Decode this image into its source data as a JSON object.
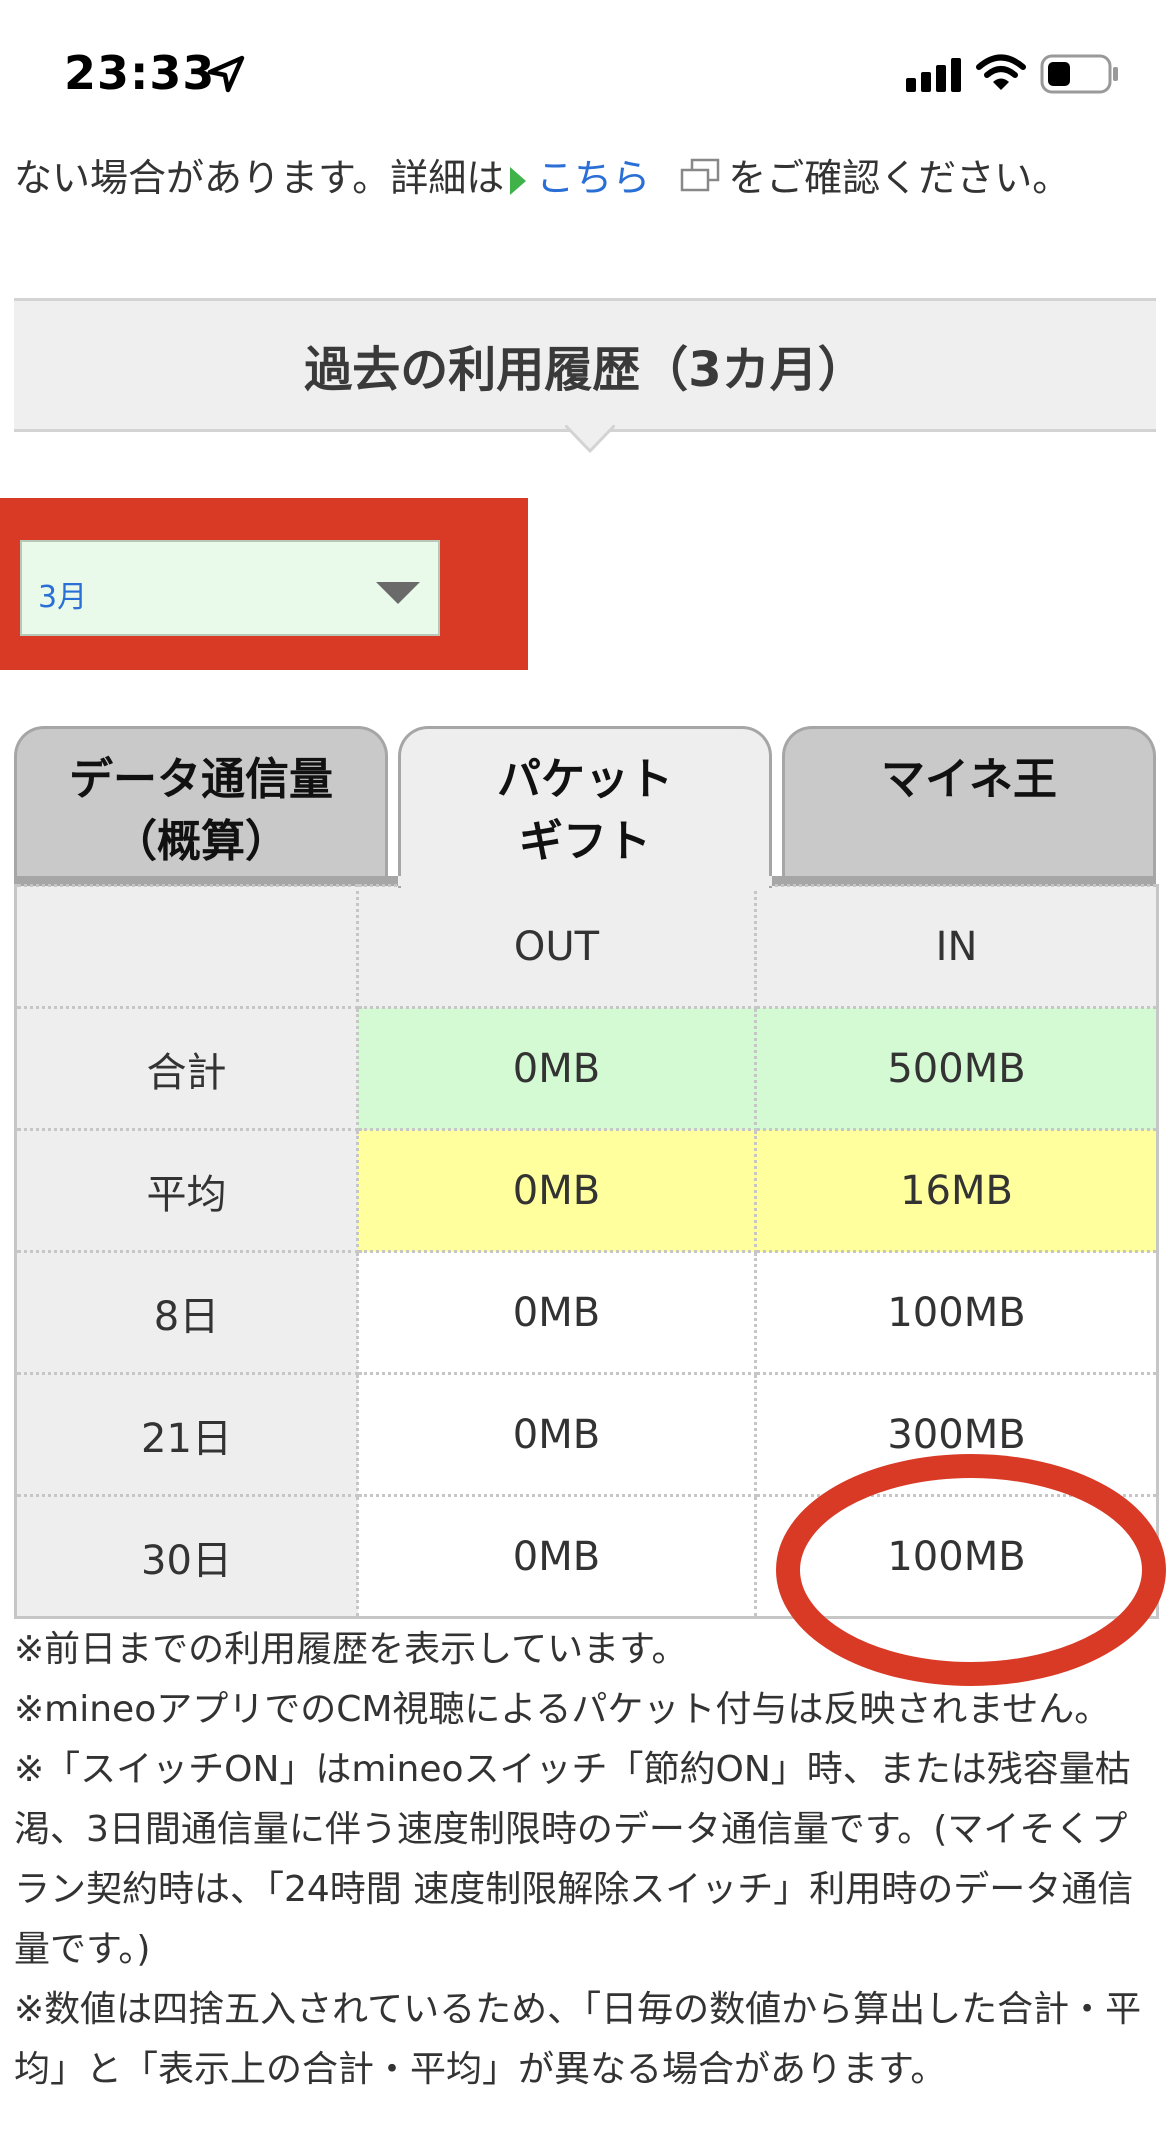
{
  "status_bar": {
    "time": "23:33"
  },
  "intro": {
    "text_before": "ない場合があります。詳細は",
    "link_text": "こちら",
    "text_after": "をご確認ください。"
  },
  "section": {
    "title": "過去の利用履歴（3カ月）"
  },
  "month_select": {
    "value": "3月"
  },
  "tabs": [
    {
      "line1": "データ通信量",
      "line2": "（概算）",
      "active": false
    },
    {
      "line1": "パケット",
      "line2": "ギフト",
      "active": true
    },
    {
      "line1": "マイネ王",
      "line2": "",
      "active": false
    }
  ],
  "table": {
    "columns": [
      "",
      "OUT",
      "IN"
    ],
    "rows": [
      {
        "label": "合計",
        "out": "0MB",
        "in": "500MB"
      },
      {
        "label": "平均",
        "out": "0MB",
        "in": "16MB"
      },
      {
        "label": "8日",
        "out": "0MB",
        "in": "100MB"
      },
      {
        "label": "21日",
        "out": "0MB",
        "in": "300MB"
      },
      {
        "label": "30日",
        "out": "0MB",
        "in": "100MB"
      }
    ]
  },
  "notes": [
    "※前日までの利用履歴を表示しています。",
    "※mineoアプリでのCM視聴によるパケット付与は反映されません。",
    "※「スイッチON」はmineoスイッチ「節約ON」時、または残容量枯渇、3日間通信量に伴う速度制限時のデータ通信量です。(マイそくプラン契約時は、「24時間 速度制限解除スイッチ」利用時のデータ通信量です。)",
    "※数値は四捨五入されているため、「日毎の数値から算出した合計・平均」と「表示上の合計・平均」が異なる場合があります。"
  ],
  "colors": {
    "accent_link": "#2a6fd6",
    "highlight_red": "#d93a26",
    "total_row": "#d4fad4",
    "average_row": "#ffff9e"
  }
}
